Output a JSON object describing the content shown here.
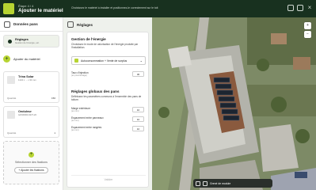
{
  "header": {
    "step": "Étape 4 / 4",
    "title": "Ajouter le matériel",
    "tagline": "Choisissez le matériel à installer et positionnez-le correctement sur le toit"
  },
  "sidebar": {
    "title": "Données pans",
    "active_item": {
      "label": "Réglages",
      "sub": "Gestion de l'énergie, etc."
    },
    "add_label": "Ajouter du matériel",
    "items": [
      {
        "name": "Trina Solar",
        "sub": "1134 x ... x 30 mm",
        "qty_label": "Quantité",
        "qty": "150"
      },
      {
        "name": "Onduleur",
        "sub": "GW30000-SDT-20",
        "qty_label": "Quantité",
        "qty": "1"
      }
    ],
    "select_text": "Sélectionner des fixations",
    "select_button": "+ Ajouter les fixations"
  },
  "panel": {
    "title": "Réglages",
    "energy_title": "Gestion de l'énergie",
    "energy_desc": "Choisissez le mode de valorisation de l'énergie produite par l'installation.",
    "energy_option": "Autoconsommation + Vente de surplus",
    "rate_label": "Taux d'injection",
    "rate_sub": "(en pourcentage)",
    "rate_value": "30",
    "global_title": "Réglages globaux des pans",
    "global_desc": "Définissez les paramètres communs à l'ensemble des pans de toiture.",
    "fields": [
      {
        "label": "Marge extérieure",
        "sub": "(en mm)",
        "value": "10"
      },
      {
        "label": "Espacement entre panneaux",
        "sub": "(en mm)",
        "value": "10"
      },
      {
        "label": "Espacement entre rangées",
        "sub": "(en mm)",
        "value": "10"
      }
    ],
    "validate": "Valider"
  },
  "map": {
    "toolbar_label": "Grené de module",
    "zoom_in": "+",
    "zoom_out": "−"
  },
  "icons": [
    "logo-icon",
    "help-icon",
    "fullscreen-icon",
    "close-icon",
    "chip-icon",
    "plus-icon",
    "chevron-down-icon",
    "cursor-icon",
    "layout-icon"
  ],
  "colors": {
    "brand_dark": "#18311f",
    "accent": "#b7d432"
  }
}
